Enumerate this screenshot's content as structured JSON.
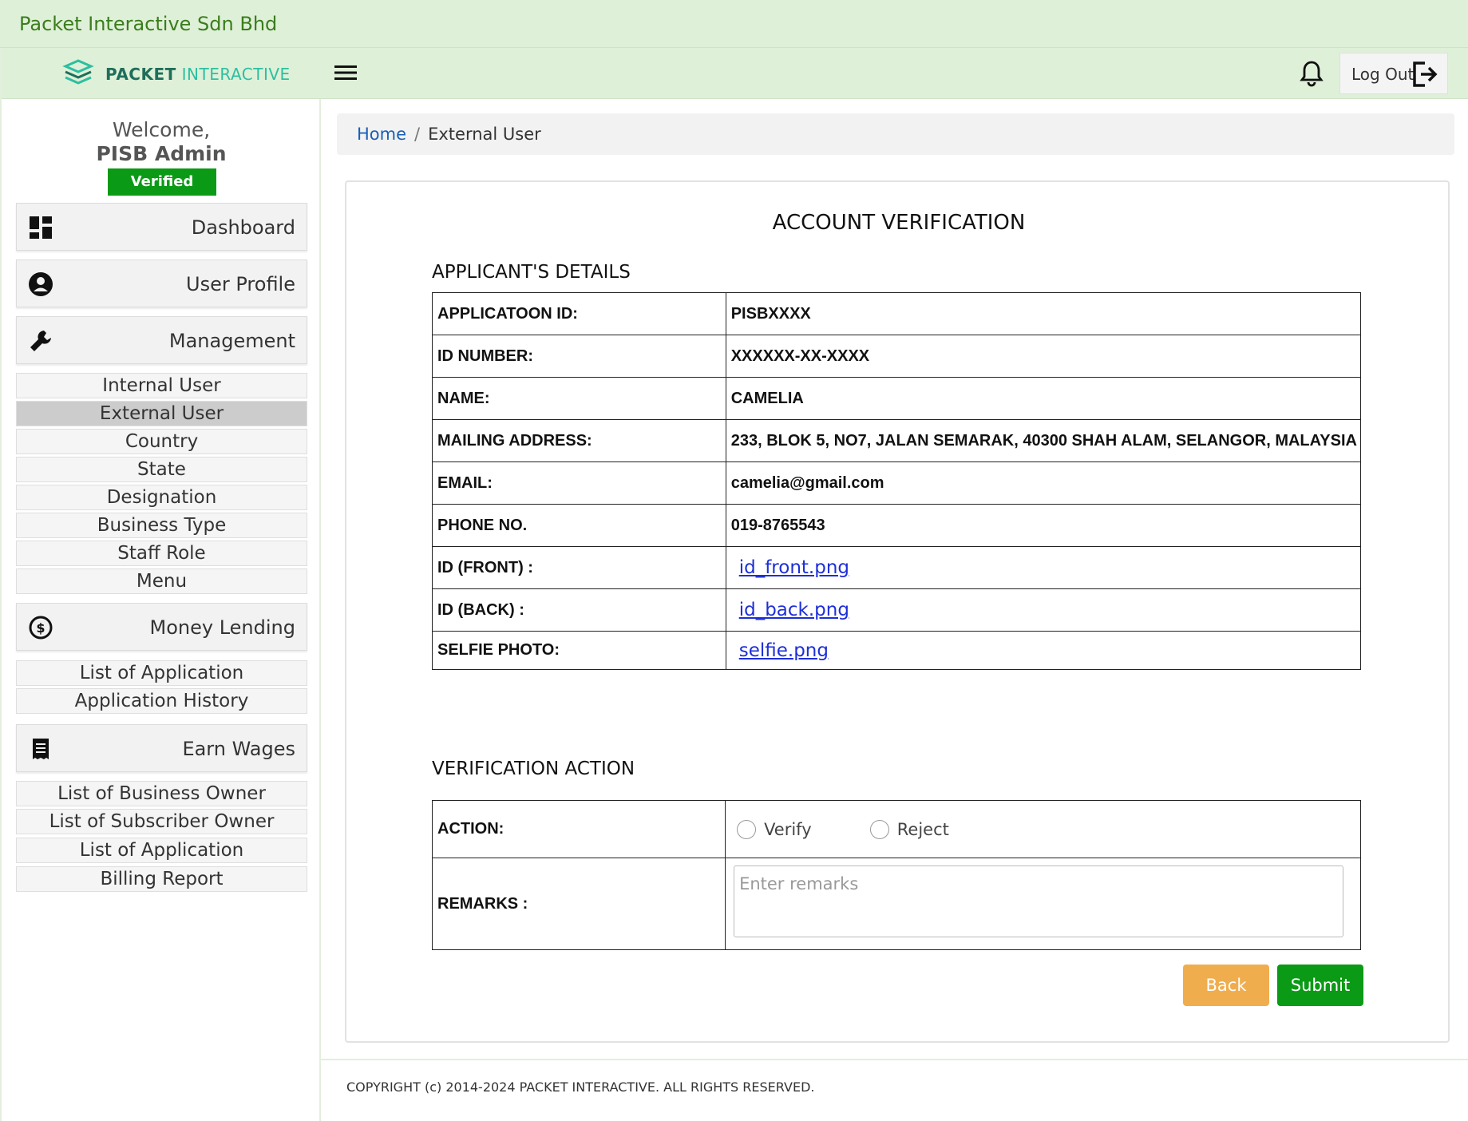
{
  "app": {
    "company_name": "Packet Interactive Sdn Bhd",
    "brand_bold": "PACKET",
    "brand_light": "INTERACTIVE"
  },
  "colors": {
    "header_bg": "#dff0d8",
    "verified": "#0b9a15",
    "back_button": "#f0ad4e",
    "submit_button": "#0b9a15",
    "link": "#1d2fd8"
  },
  "user": {
    "welcome": "Welcome,",
    "name": "PISB Admin",
    "badge": "Verified"
  },
  "sidebar": {
    "dashboard": {
      "label": "Dashboard",
      "icon": "dashboard-icon"
    },
    "user_profile": {
      "label": "User Profile",
      "icon": "user-circle-icon"
    },
    "management": {
      "label": "Management",
      "icon": "wrench-icon",
      "items": [
        "Internal User",
        "External User",
        "Country",
        "State",
        "Designation",
        "Business Type",
        "Staff Role",
        "Menu"
      ]
    },
    "money_lending": {
      "label": "Money Lending",
      "icon": "dollar-circle-icon",
      "items": [
        "List of Application",
        "Application History"
      ]
    },
    "earn_wages": {
      "label": "Earn Wages",
      "icon": "receipt-icon",
      "items": [
        "List of Business Owner",
        "List of Subscriber Owner",
        "List of Application",
        "Billing Report"
      ]
    },
    "active_item": "External User"
  },
  "header": {
    "logout_label": "Log Out"
  },
  "breadcrumb": {
    "home": "Home",
    "separator": "/",
    "current": "External User"
  },
  "form": {
    "title": "ACCOUNT VERIFICATION",
    "applicant_section": "APPLICANT'S DETAILS",
    "details": [
      {
        "label": "APPLICATOON ID:",
        "value": "PISBXXXX"
      },
      {
        "label": "ID NUMBER:",
        "value": "XXXXXX-XX-XXXX"
      },
      {
        "label": "NAME:",
        "value": "CAMELIA"
      },
      {
        "label": "MAILING ADDRESS:",
        "value": "233, BLOK 5, NO7, JALAN SEMARAK, 40300 SHAH ALAM, SELANGOR, MALAYSIA"
      },
      {
        "label": "EMAIL:",
        "value": "camelia@gmail.com"
      },
      {
        "label": "PHONE NO.",
        "value": "019-8765543"
      },
      {
        "label": "ID (FRONT) :",
        "link": "id_front.png"
      },
      {
        "label": "ID (BACK) :",
        "link": "id_back.png"
      },
      {
        "label": "SELFIE PHOTO:",
        "link": "selfie.png"
      }
    ],
    "verification_section": "VERIFICATION ACTION",
    "action_label": "ACTION:",
    "options": [
      "Verify",
      "Reject"
    ],
    "remarks_label": "REMARKS :",
    "remarks_placeholder": "Enter remarks",
    "remarks_value": "",
    "back_label": "Back",
    "submit_label": "Submit"
  },
  "footer": {
    "copyright": "COPYRIGHT (c) 2014-2024 PACKET INTERACTIVE. ALL RIGHTS RESERVED."
  }
}
